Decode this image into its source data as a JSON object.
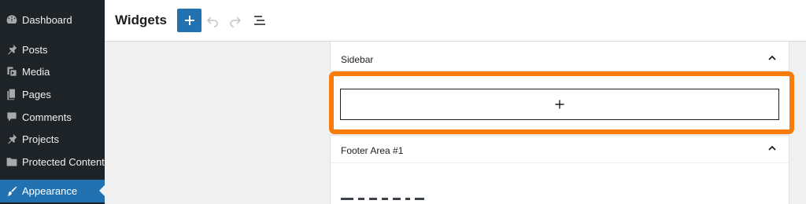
{
  "sidebar": {
    "items": [
      {
        "label": "Dashboard",
        "icon": "dashboard-icon"
      },
      {
        "label": "Posts",
        "icon": "pin-icon"
      },
      {
        "label": "Media",
        "icon": "media-icon"
      },
      {
        "label": "Pages",
        "icon": "pages-icon"
      },
      {
        "label": "Comments",
        "icon": "comment-icon"
      },
      {
        "label": "Projects",
        "icon": "pin-icon"
      },
      {
        "label": "Protected Content",
        "icon": "folder-icon"
      },
      {
        "label": "Appearance",
        "icon": "brush-icon"
      }
    ],
    "active": "Appearance"
  },
  "header": {
    "title": "Widgets",
    "add_button": "add-block-icon",
    "undo": "undo-icon",
    "redo": "redo-icon",
    "list_view": "list-view-icon"
  },
  "widget_areas": [
    {
      "title": "Sidebar",
      "expanded": true
    },
    {
      "title": "Footer Area #1",
      "expanded": true
    }
  ],
  "colors": {
    "sidebar_bg": "#1d2327",
    "active_bg": "#2271b1",
    "highlight": "#f97c08"
  }
}
